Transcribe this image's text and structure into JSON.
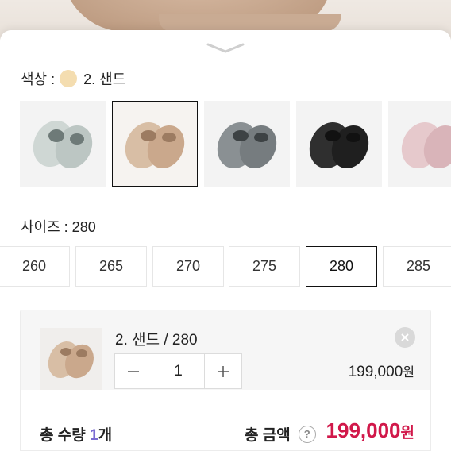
{
  "color": {
    "label": "색상 :",
    "selected_value": "2. 샌드",
    "selected_swatch": "#f4ddb0",
    "options": [
      {
        "name": "mint-grey",
        "tone": "#c9d2cf"
      },
      {
        "name": "sand",
        "tone": "#d3b79c",
        "selected": true
      },
      {
        "name": "grey",
        "tone": "#7f8587"
      },
      {
        "name": "black",
        "tone": "#2b2b2b"
      },
      {
        "name": "pink",
        "tone": "#e2c2c6"
      }
    ]
  },
  "size": {
    "label": "사이즈 : 280",
    "options": [
      "260",
      "265",
      "270",
      "275",
      "280",
      "285"
    ],
    "selected": "280"
  },
  "selection": {
    "name": "2. 샌드 / 280",
    "quantity": "1",
    "price": "199,000",
    "currency": "원"
  },
  "total": {
    "qty_prefix": "총 수량 ",
    "qty_value": "1",
    "qty_suffix": "개",
    "amount_label": "총 금액",
    "amount_value": "199,000",
    "currency": "원"
  },
  "colors": {
    "accent_price": "#d1184a",
    "accent_qty": "#7a6bd1",
    "selected_border": "#111111"
  }
}
